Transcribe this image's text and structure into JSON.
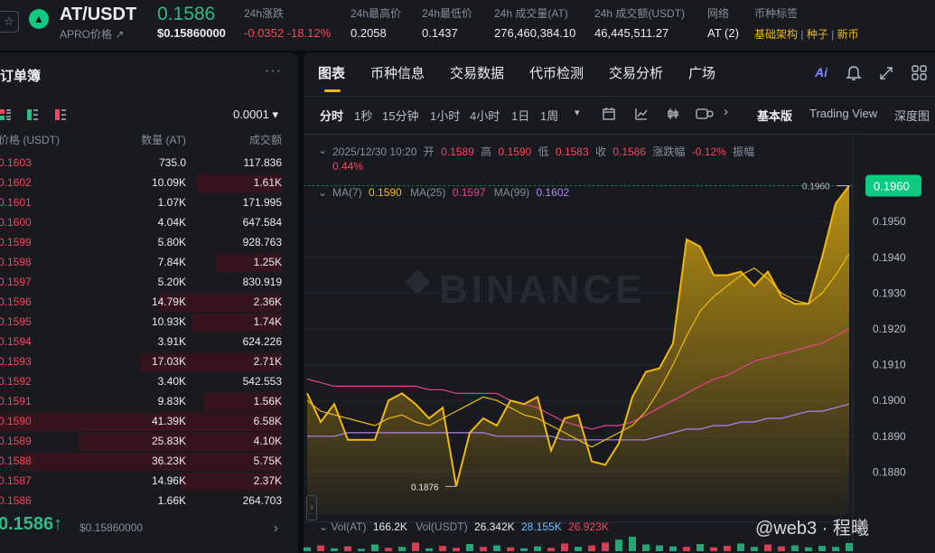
{
  "header": {
    "pair": "AT/USDT",
    "sub": "APRO价格 ↗",
    "last_price": "0.1586",
    "last_usd": "$0.15860000",
    "stats": [
      {
        "label": "24h涨跌",
        "value": "-0.0352 -18.12%",
        "color": "#f6465d"
      },
      {
        "label": "24h最高价",
        "value": "0.2058",
        "color": "#eaecef"
      },
      {
        "label": "24h最低价",
        "value": "0.1437",
        "color": "#eaecef"
      },
      {
        "label": "24h 成交量(AT)",
        "value": "276,460,384.10",
        "color": "#eaecef"
      },
      {
        "label": "24h 成交额(USDT)",
        "value": "46,445,511.27",
        "color": "#eaecef"
      },
      {
        "label": "网络",
        "value": "AT (2)",
        "color": "#eaecef"
      }
    ],
    "tags_label": "币种标签",
    "tags": [
      "基础架构",
      "种子",
      "新币"
    ]
  },
  "orderbook": {
    "title": "订单簿",
    "more": "···",
    "step": "0.0001 ▾",
    "columns": [
      "价格 (USDT)",
      "数量 (AT)",
      "成交额"
    ],
    "rows": [
      {
        "price": "0.1603",
        "qty": "735.0",
        "total": "117.836",
        "depth": 0
      },
      {
        "price": "0.1602",
        "qty": "10.09K",
        "total": "1.61K",
        "depth": 0.3
      },
      {
        "price": "0.1601",
        "qty": "1.07K",
        "total": "171.995",
        "depth": 0
      },
      {
        "price": "0.1600",
        "qty": "4.04K",
        "total": "647.584",
        "depth": 0
      },
      {
        "price": "0.1599",
        "qty": "5.80K",
        "total": "928.763",
        "depth": 0
      },
      {
        "price": "0.1598",
        "qty": "7.84K",
        "total": "1.25K",
        "depth": 0.23
      },
      {
        "price": "0.1597",
        "qty": "5.20K",
        "total": "830.919",
        "depth": 0
      },
      {
        "price": "0.1596",
        "qty": "14.79K",
        "total": "2.36K",
        "depth": 0.44
      },
      {
        "price": "0.1595",
        "qty": "10.93K",
        "total": "1.74K",
        "depth": 0.32
      },
      {
        "price": "0.1594",
        "qty": "3.91K",
        "total": "624.226",
        "depth": 0
      },
      {
        "price": "0.1593",
        "qty": "17.03K",
        "total": "2.71K",
        "depth": 0.5
      },
      {
        "price": "0.1592",
        "qty": "3.40K",
        "total": "542.553",
        "depth": 0
      },
      {
        "price": "0.1591",
        "qty": "9.83K",
        "total": "1.56K",
        "depth": 0.28
      },
      {
        "price": "0.1590",
        "qty": "41.39K",
        "total": "6.58K",
        "depth": 1.0
      },
      {
        "price": "0.1589",
        "qty": "25.83K",
        "total": "4.10K",
        "depth": 0.72
      },
      {
        "price": "0.1588",
        "qty": "36.23K",
        "total": "5.75K",
        "depth": 0.93
      },
      {
        "price": "0.1587",
        "qty": "14.96K",
        "total": "2.37K",
        "depth": 0.36
      },
      {
        "price": "0.1586",
        "qty": "1.66K",
        "total": "264.703",
        "depth": 0
      }
    ],
    "last_price": "0.1586↑",
    "last_usd": "$0.15860000",
    "more_arrow": "›"
  },
  "chart_panel": {
    "tabs": [
      "图表",
      "币种信息",
      "交易数据",
      "代币检测",
      "交易分析",
      "广场"
    ],
    "active_tab": "图表",
    "intervals": [
      "分时",
      "1秒",
      "15分钟",
      "1小时",
      "4小时",
      "1日",
      "1周"
    ],
    "active_interval": "分时",
    "views": [
      "基本版",
      "Trading View",
      "深度图"
    ],
    "active_view": "基本版",
    "ohlc": {
      "date": "2025/12/30 10:20",
      "open_label": "开",
      "open": "0.1589",
      "high_label": "高",
      "high": "0.1590",
      "low_label": "低",
      "low": "0.1583",
      "close_label": "收",
      "close": "0.1586",
      "chg_label": "涨跌幅",
      "chg": "-0.12%",
      "amp_label": "振幅",
      "amp": "0.44%"
    },
    "ma": [
      {
        "label": "MA(7)",
        "value": "0.1590",
        "color": "#f0b90b"
      },
      {
        "label": "MA(25)",
        "value": "0.1597",
        "color": "#e84393"
      },
      {
        "label": "MA(99)",
        "value": "0.1602",
        "color": "#b084f5"
      }
    ],
    "vol_text": {
      "vol_label": "Vol(AT)",
      "vol": "166.2K",
      "volu_label": "Vol(USDT)",
      "volu": "26.342K",
      "ma1": "28.155K",
      "ma2": "26.923K"
    },
    "watermark": "BINANCE",
    "overlay_caption": "@web3 · 程曦"
  },
  "chart_data": {
    "type": "line",
    "y_ticks": [
      "0.1960",
      "0.1950",
      "0.1940",
      "0.1930",
      "0.1920",
      "0.1910",
      "0.1900",
      "0.1890",
      "0.1880"
    ],
    "ylim": [
      0.1868,
      0.1972
    ],
    "current_price_label": "0.1960",
    "max_label": "0.1960",
    "min_label": "0.1876",
    "series": [
      {
        "name": "MA(7)",
        "color": "#f0b90b",
        "values": [
          0.19,
          0.1897,
          0.1896,
          0.1895,
          0.1894,
          0.1893,
          0.1895,
          0.1896,
          0.1894,
          0.1893,
          0.1895,
          0.1897,
          0.1899,
          0.1901,
          0.19,
          0.1898,
          0.1896,
          0.1895,
          0.1893,
          0.1891,
          0.1889,
          0.1887,
          0.1889,
          0.1891,
          0.1893,
          0.1897,
          0.1903,
          0.191,
          0.1918,
          0.1925,
          0.1929,
          0.1932,
          0.1935,
          0.1937,
          0.1934,
          0.193,
          0.1928,
          0.1927,
          0.193,
          0.1935,
          0.1941
        ]
      },
      {
        "name": "MA(25)",
        "color": "#e84393",
        "values": [
          0.1906,
          0.1905,
          0.1904,
          0.1904,
          0.1904,
          0.1904,
          0.1904,
          0.1904,
          0.1904,
          0.1903,
          0.1903,
          0.1902,
          0.1902,
          0.1902,
          0.1902,
          0.19,
          0.1899,
          0.1898,
          0.1896,
          0.1894,
          0.1893,
          0.1892,
          0.1893,
          0.1893,
          0.1894,
          0.1896,
          0.1898,
          0.19,
          0.1902,
          0.1904,
          0.1906,
          0.1907,
          0.1909,
          0.1911,
          0.1912,
          0.1913,
          0.1914,
          0.1915,
          0.1916,
          0.1918,
          0.192
        ]
      },
      {
        "name": "MA(99)",
        "color": "#b084f5",
        "values": [
          0.189,
          0.189,
          0.189,
          0.1891,
          0.1891,
          0.1891,
          0.1891,
          0.1891,
          0.1891,
          0.1891,
          0.1891,
          0.1891,
          0.1891,
          0.1891,
          0.189,
          0.189,
          0.189,
          0.189,
          0.189,
          0.1889,
          0.1889,
          0.1889,
          0.1889,
          0.1889,
          0.1889,
          0.1889,
          0.189,
          0.1891,
          0.1892,
          0.1892,
          0.1893,
          0.1893,
          0.1894,
          0.1894,
          0.1895,
          0.1895,
          0.1896,
          0.1897,
          0.1897,
          0.1898,
          0.1899
        ]
      }
    ],
    "price_points": [
      [
        0,
        0.1902
      ],
      [
        1,
        0.1894
      ],
      [
        2,
        0.1899
      ],
      [
        3,
        0.1889
      ],
      [
        4,
        0.1889
      ],
      [
        5,
        0.1889
      ],
      [
        6,
        0.19
      ],
      [
        7,
        0.1902
      ],
      [
        8,
        0.1899
      ],
      [
        9,
        0.1895
      ],
      [
        10,
        0.1898
      ],
      [
        11,
        0.1876
      ],
      [
        12,
        0.1891
      ],
      [
        13,
        0.1895
      ],
      [
        14,
        0.1893
      ],
      [
        15,
        0.19
      ],
      [
        16,
        0.1899
      ],
      [
        17,
        0.1901
      ],
      [
        18,
        0.1886
      ],
      [
        19,
        0.1895
      ],
      [
        20,
        0.1896
      ],
      [
        21,
        0.1883
      ],
      [
        22,
        0.1882
      ],
      [
        23,
        0.1888
      ],
      [
        24,
        0.1901
      ],
      [
        25,
        0.1908
      ],
      [
        26,
        0.1909
      ],
      [
        27,
        0.1916
      ],
      [
        28,
        0.1945
      ],
      [
        29,
        0.1943
      ],
      [
        30,
        0.1935
      ],
      [
        31,
        0.1935
      ],
      [
        32,
        0.1936
      ],
      [
        33,
        0.1932
      ],
      [
        34,
        0.1936
      ],
      [
        35,
        0.1929
      ],
      [
        36,
        0.1927
      ],
      [
        37,
        0.1927
      ],
      [
        38,
        0.194
      ],
      [
        39,
        0.1955
      ],
      [
        40,
        0.196
      ]
    ],
    "volume": {
      "values": [
        8,
        12,
        6,
        10,
        5,
        14,
        7,
        9,
        18,
        6,
        11,
        7,
        15,
        9,
        12,
        8,
        6,
        10,
        7,
        16,
        9,
        12,
        18,
        24,
        30,
        14,
        12,
        10,
        9,
        15,
        8,
        11,
        16,
        9,
        14,
        10,
        12,
        8,
        11,
        9,
        17
      ],
      "up": [
        1,
        0,
        1,
        0,
        1,
        1,
        0,
        1,
        0,
        1,
        0,
        0,
        1,
        0,
        1,
        0,
        1,
        1,
        0,
        0,
        1,
        0,
        0,
        1,
        1,
        1,
        1,
        1,
        0,
        1,
        0,
        0,
        1,
        1,
        0,
        0,
        1,
        1,
        1,
        1,
        1
      ]
    }
  },
  "colors": {
    "up": "#2ebd85",
    "down": "#f6465d",
    "accent": "#f0b90b",
    "bg": "#0b0e11",
    "panel": "#181a20",
    "muted": "#848e9c"
  }
}
